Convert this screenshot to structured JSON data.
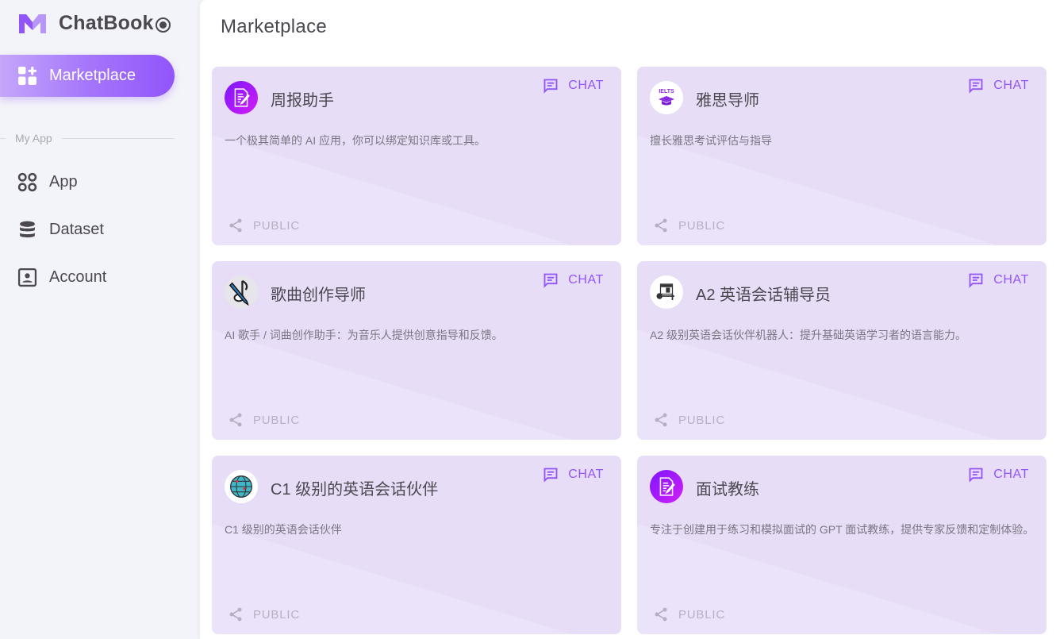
{
  "app": {
    "name": "ChatBook",
    "logo_icon": "m-logo-icon",
    "brand_color": "#9155fb"
  },
  "sidebar": {
    "active_item": {
      "label": "Marketplace",
      "icon": "marketplace-grid-icon"
    },
    "section_label": "My App",
    "items": [
      {
        "label": "App",
        "icon": "app-grid-icon"
      },
      {
        "label": "Dataset",
        "icon": "database-icon"
      },
      {
        "label": "Account",
        "icon": "account-box-icon"
      }
    ]
  },
  "main": {
    "title": "Marketplace",
    "cards": [
      {
        "title": "周报助手",
        "description": "一个极其简单的 AI 应用，你可以绑定知识库或工具。",
        "avatar": "document-edit-icon",
        "action_label": "CHAT",
        "visibility": "PUBLIC"
      },
      {
        "title": "雅思导师",
        "description": "擅长雅思考试评估与指导",
        "avatar": "ielts-cap-icon",
        "action_label": "CHAT",
        "visibility": "PUBLIC"
      },
      {
        "title": "歌曲创作导师",
        "description": "AI 歌手 / 词曲创作助手：为音乐人提供创意指导和反馈。",
        "avatar": "music-pen-icon",
        "action_label": "CHAT",
        "visibility": "PUBLIC"
      },
      {
        "title": "A2 英语会话辅导员",
        "description": "A2 级别英语会话伙伴机器人：提升基础英语学习者的语言能力。",
        "avatar": "computer-desk-icon",
        "action_label": "CHAT",
        "visibility": "PUBLIC"
      },
      {
        "title": "C1 级别的英语会话伙伴",
        "description": "C1 级别的英语会话伙伴",
        "avatar": "globe-icon",
        "action_label": "CHAT",
        "visibility": "PUBLIC"
      },
      {
        "title": "面试教练",
        "description": "专注于创建用于练习和模拟面试的 GPT 面试教练，提供专家反馈和定制体验。",
        "avatar": "document-edit-icon",
        "action_label": "CHAT",
        "visibility": "PUBLIC"
      }
    ]
  }
}
